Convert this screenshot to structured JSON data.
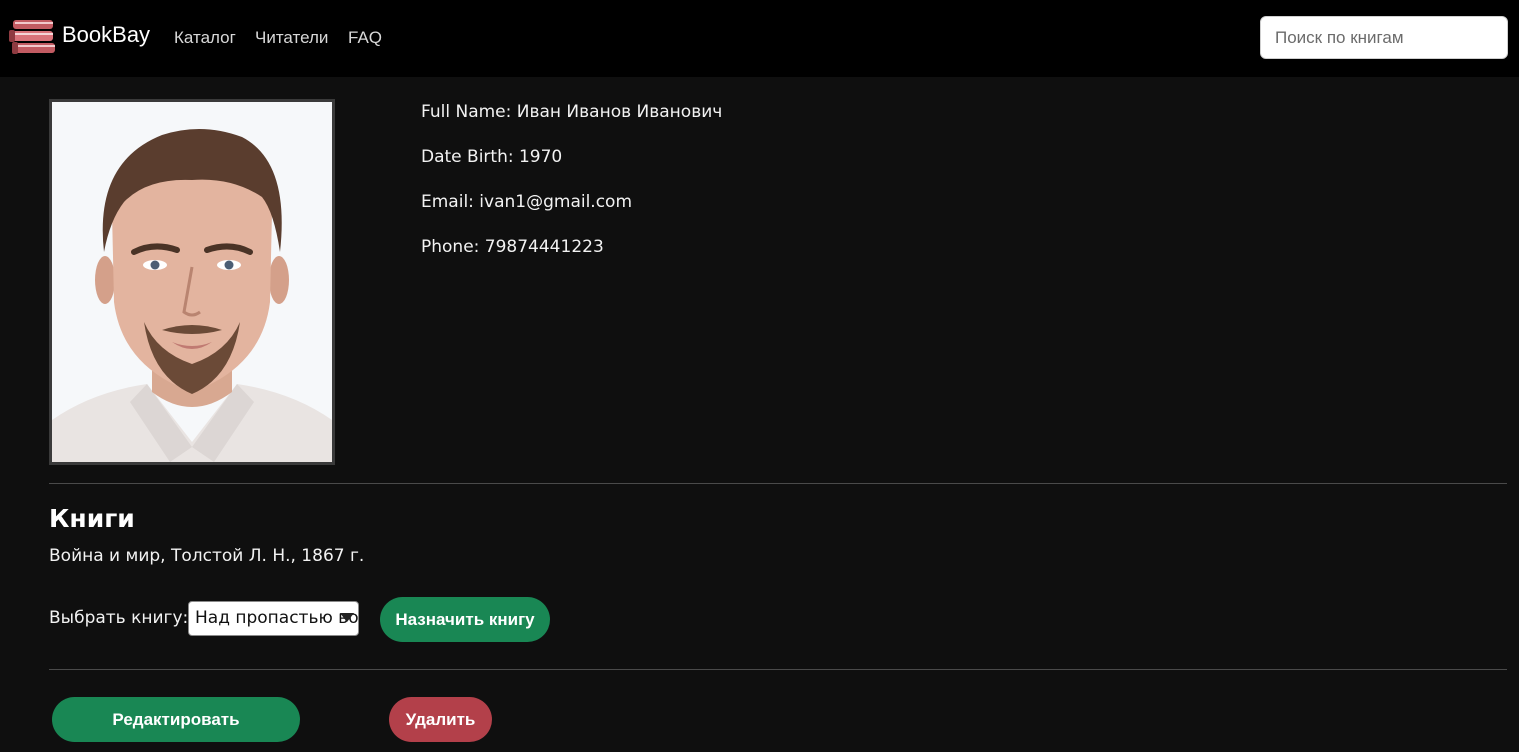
{
  "navbar": {
    "brand": "BookBay",
    "brand_icon": "books-icon",
    "links": [
      "Каталог",
      "Читатели",
      "FAQ"
    ],
    "search_placeholder": "Поиск по книгам"
  },
  "profile": {
    "full_name": "Full Name: Иван Иванов Иванович",
    "date_birth": "Date Birth: 1970",
    "email": "Email: ivan1@gmail.com",
    "phone": "Phone: 79874441223"
  },
  "books": {
    "title": "Книги",
    "items": [
      "Война и мир, Толстой Л. Н., 1867 г."
    ],
    "select_label": "Выбрать книгу:",
    "select_value": "Над пропастью во ржи",
    "assign_button": "Назначить книгу"
  },
  "actions": {
    "edit_button": "Редактировать",
    "delete_button": "Удалить"
  },
  "colors": {
    "navbar_bg": "#000000",
    "page_bg": "#0f0f0f",
    "primary_green": "#198754",
    "danger_red": "#b3404a"
  }
}
